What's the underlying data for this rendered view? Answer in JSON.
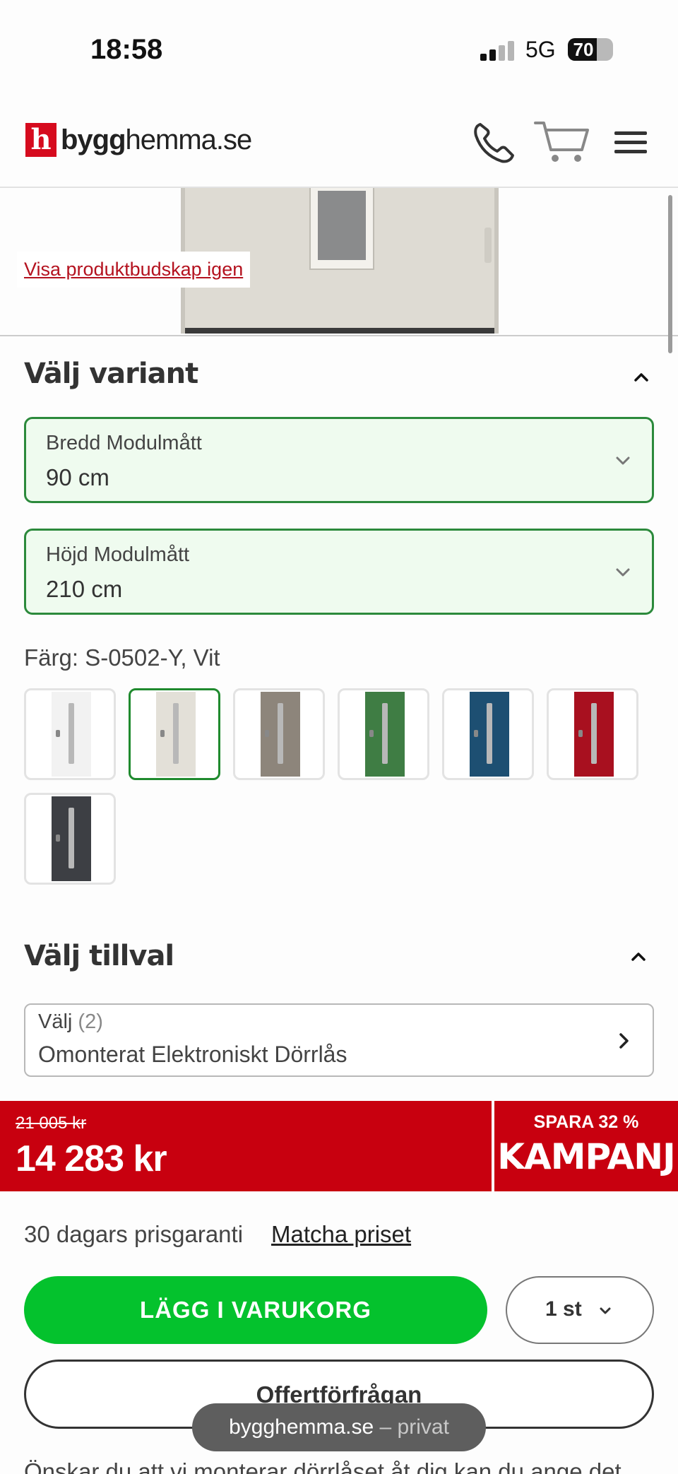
{
  "status_bar": {
    "time": "18:58",
    "network": "5G",
    "battery": "70",
    "battery_level_percent": 70
  },
  "header": {
    "logo_mark": "h",
    "logo_text_bold": "bygg",
    "logo_text_rest": "hemma.se",
    "icons": [
      "phone-icon",
      "cart-icon",
      "menu-icon"
    ]
  },
  "product_image": {
    "show_message_link": "Visa produktbudskap igen"
  },
  "variant_section": {
    "title": "Välj variant",
    "width_select": {
      "label": "Bredd Modulmått",
      "value": "90 cm"
    },
    "height_select": {
      "label": "Höjd Modulmått",
      "value": "210 cm"
    },
    "color_label": "Färg: S-0502-Y, Vit",
    "colors": [
      {
        "name": "white",
        "hex": "#f2f2f2",
        "selected": false
      },
      {
        "name": "off-white",
        "hex": "#e3e0d8",
        "selected": true
      },
      {
        "name": "grey-brown",
        "hex": "#8d857b",
        "selected": false
      },
      {
        "name": "green",
        "hex": "#3f7d44",
        "selected": false
      },
      {
        "name": "blue",
        "hex": "#1d4f72",
        "selected": false
      },
      {
        "name": "red",
        "hex": "#a8101f",
        "selected": false
      },
      {
        "name": "anthracite",
        "hex": "#3d3f44",
        "selected": false
      }
    ]
  },
  "options_section": {
    "title": "Välj tillval",
    "select_label": "Välj",
    "select_count": "(2)",
    "select_value": "Omonterat Elektroniskt Dörrlås"
  },
  "price": {
    "old_price": "21 005 kr",
    "new_price": "14 283 kr",
    "save_text": "SPARA 32 %",
    "campaign_text": "KAMPANJ"
  },
  "guarantee": {
    "text": "30 dagars prisgaranti",
    "match_link": "Matcha priset"
  },
  "actions": {
    "add_to_cart": "LÄGG I VARUKORG",
    "quantity": "1 st",
    "offer_request": "Offertförfrågan"
  },
  "toast": {
    "domain": "bygghemma.se",
    "suffix": "– privat"
  },
  "footer_text": "Önskar du att vi monterar dörrlåset åt dig kan du ange det"
}
